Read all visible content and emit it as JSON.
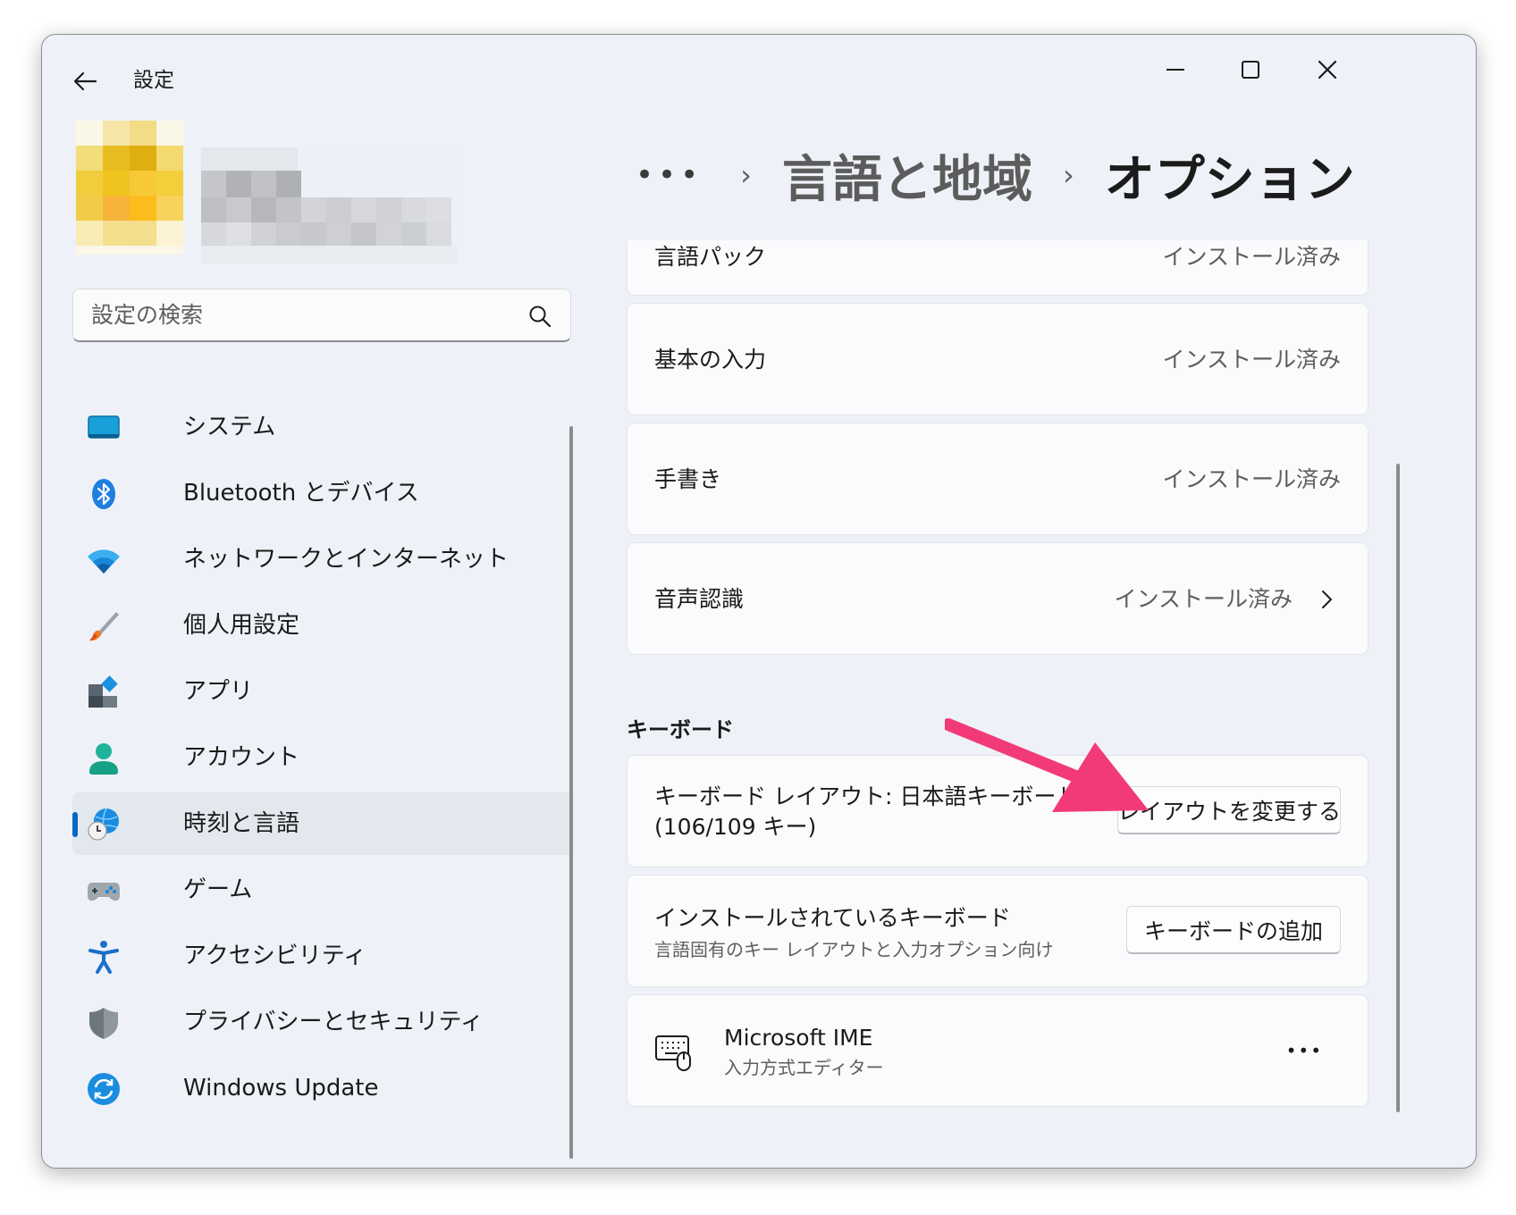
{
  "window": {
    "title": "設定",
    "controls": {
      "minimize": "minimize-icon",
      "maximize": "maximize-icon",
      "close": "close-icon"
    }
  },
  "search": {
    "placeholder": "設定の検索"
  },
  "nav": {
    "items": [
      {
        "label": "システム",
        "icon": "system-icon"
      },
      {
        "label": "Bluetooth とデバイス",
        "icon": "bluetooth-icon"
      },
      {
        "label": "ネットワークとインターネット",
        "icon": "network-icon"
      },
      {
        "label": "個人用設定",
        "icon": "brush-icon"
      },
      {
        "label": "アプリ",
        "icon": "apps-icon"
      },
      {
        "label": "アカウント",
        "icon": "account-icon"
      },
      {
        "label": "時刻と言語",
        "icon": "time-language-icon",
        "selected": true
      },
      {
        "label": "ゲーム",
        "icon": "gamepad-icon"
      },
      {
        "label": "アクセシビリティ",
        "icon": "accessibility-icon"
      },
      {
        "label": "プライバシーとセキュリティ",
        "icon": "shield-icon"
      },
      {
        "label": "Windows Update",
        "icon": "update-icon"
      }
    ]
  },
  "breadcrumb": {
    "ellipsis": "•••",
    "separator": "›",
    "parent": "言語と地域",
    "current": "オプション"
  },
  "language_features": [
    {
      "name": "言語パック",
      "status": "インストール済み"
    },
    {
      "name": "基本の入力",
      "status": "インストール済み"
    },
    {
      "name": "手書き",
      "status": "インストール済み"
    },
    {
      "name": "音声認識",
      "status": "インストール済み",
      "chevron": "chevron-right-icon"
    }
  ],
  "keyboard": {
    "section_title": "キーボード",
    "layout": {
      "line1": "キーボード レイアウト: 日本語キーボード",
      "line2": "(106/109 キー)",
      "button": "レイアウトを変更する"
    },
    "installed": {
      "title": "インストールされているキーボード",
      "subtitle": "言語固有のキー レイアウトと入力オプション向け",
      "button": "キーボードの追加"
    },
    "ime": {
      "name": "Microsoft IME",
      "subtitle": "入力方式エディター",
      "more": "•••"
    }
  },
  "annotation": {
    "arrow_color": "#f23a78"
  },
  "colors": {
    "accent": "#0067c0",
    "window_bg": "#eef2f8",
    "card_bg": "#fbfbfd"
  }
}
